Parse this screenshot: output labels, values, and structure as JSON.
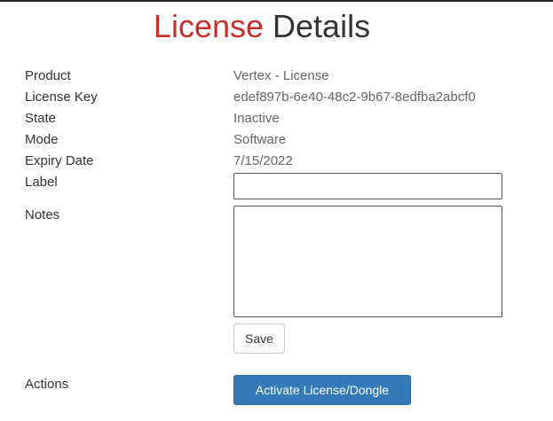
{
  "header": {
    "title_accent": "License",
    "title_rest": "Details"
  },
  "details": {
    "product_label": "Product",
    "product_value": "Vertex - License",
    "license_key_label": "License Key",
    "license_key_value": "edef897b-6e40-48c2-9b67-8edfba2abcf0",
    "state_label": "State",
    "state_value": "Inactive",
    "mode_label": "Mode",
    "mode_value": "Software",
    "expiry_label": "Expiry Date",
    "expiry_value": "7/15/2022"
  },
  "form": {
    "label_label": "Label",
    "label_value": "",
    "notes_label": "Notes",
    "notes_value": "",
    "save_label": "Save"
  },
  "actions": {
    "actions_label": "Actions",
    "activate_label": "Activate License/Dongle"
  },
  "colors": {
    "accent": "#c9302c",
    "primary_button": "#337ab7"
  }
}
